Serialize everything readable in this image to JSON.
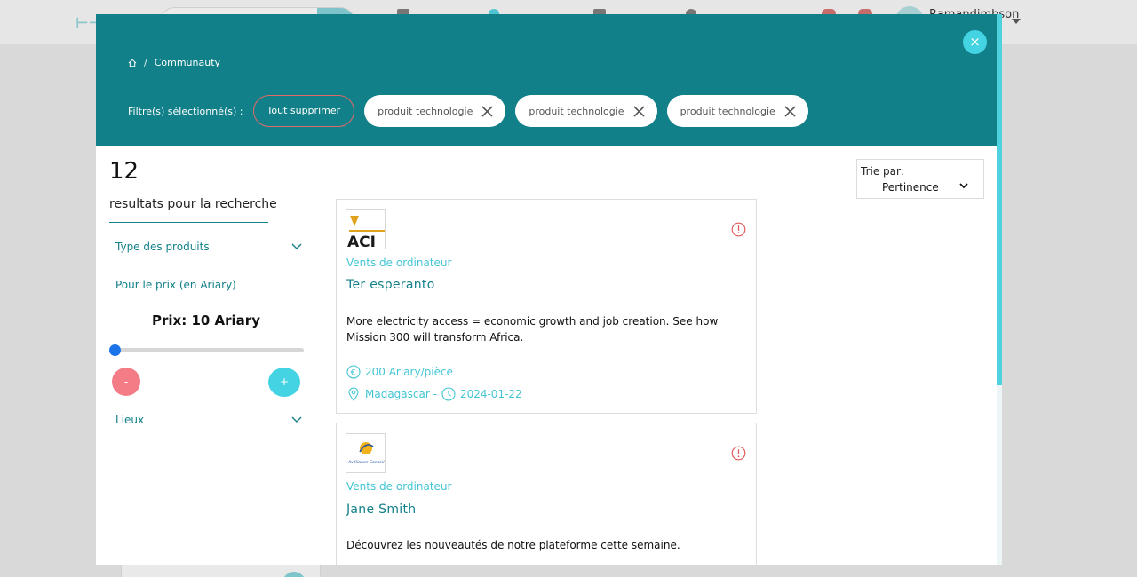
{
  "background": {
    "user_name": "Ramandimbson"
  },
  "modal": {
    "close_symbol": "×",
    "breadcrumb": {
      "separator": "/",
      "current": "Communauty"
    },
    "filters": {
      "label": "Filtre(s) sélectionné(s) :",
      "clear_all": "Tout supprimer",
      "chips": [
        {
          "label": "produit technologie"
        },
        {
          "label": "produit technologie"
        },
        {
          "label": "produit technologie"
        }
      ]
    },
    "results": {
      "count": "12",
      "subtitle": "resultats pour la recherche"
    },
    "sidebar": {
      "facets": [
        {
          "label": "Type des produits"
        },
        {
          "label": "Pour le prix (en Ariary)"
        },
        {
          "label": "Lieux"
        }
      ],
      "price": {
        "prefix": "Prix: ",
        "value": "10 Ariary",
        "slider_fraction": 0.0,
        "minus_label": "-",
        "plus_label": "+"
      }
    },
    "sort": {
      "label": "Trie par:",
      "value": "Pertinence"
    },
    "listings": [
      {
        "logo_text": "ACI",
        "category": "Vents de ordinateur",
        "title": "Ter esperanto",
        "description": "More electricity access = economic growth and job creation. See how Mission 300 will transform Africa.",
        "price": "200 Ariary/pièce",
        "location": "Madagascar -",
        "date": "2024-01-22"
      },
      {
        "logo_text": "Avéliance Conseil",
        "category": "Vents de ordinateur",
        "title": "Jane Smith",
        "description": "Découvrez les nouveautés de notre plateforme cette semaine."
      }
    ],
    "colors": {
      "header": "#128089",
      "accent": "#43d3e3",
      "link_light": "#43c5d3",
      "danger": "#f47c87",
      "slider_thumb": "#1a73e8"
    }
  }
}
